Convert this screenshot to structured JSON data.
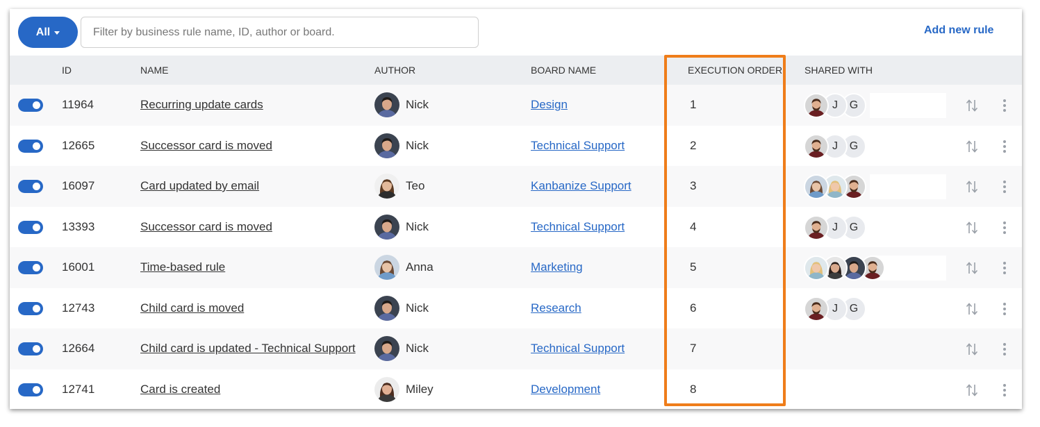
{
  "toolbar": {
    "filter_button": "All",
    "search_placeholder": "Filter by business rule name, ID, author or board.",
    "add_link": "Add new rule"
  },
  "columns": {
    "id": "ID",
    "name": "NAME",
    "author": "AUTHOR",
    "board": "BOARD NAME",
    "order": "EXECUTION ORDER",
    "shared": "SHARED WITH"
  },
  "colors": {
    "accent": "#2768c6",
    "highlight": "#ef7d1a",
    "header_bg": "#eceef1",
    "row_alt": "#f8f8f9"
  },
  "icons": {
    "filter": "chevron-down-icon",
    "row_sort": "sort-arrows-icon",
    "row_menu": "more-vertical-icon",
    "toggle": "toggle-switch-icon"
  },
  "rules": [
    {
      "enabled": true,
      "id": "11964",
      "name": "Recurring update cards",
      "author": "Nick",
      "author_avatar": "man-dark",
      "board": "Design",
      "order": "1",
      "shared": [
        {
          "type": "avatar",
          "kind": "man-beard"
        },
        {
          "type": "letter",
          "text": "J"
        },
        {
          "type": "letter",
          "text": "G"
        }
      ]
    },
    {
      "enabled": true,
      "id": "12665",
      "name": "Successor card is moved",
      "author": "Nick",
      "author_avatar": "man-dark",
      "board": "Technical Support",
      "order": "2",
      "shared": [
        {
          "type": "avatar",
          "kind": "man-beard"
        },
        {
          "type": "letter",
          "text": "J"
        },
        {
          "type": "letter",
          "text": "G"
        }
      ]
    },
    {
      "enabled": true,
      "id": "16097",
      "name": "Card updated by email",
      "author": "Teo",
      "author_avatar": "woman-long",
      "board": "Kanbanize Support",
      "order": "3",
      "shared": [
        {
          "type": "avatar",
          "kind": "woman-blue"
        },
        {
          "type": "avatar",
          "kind": "woman-blonde"
        },
        {
          "type": "avatar",
          "kind": "man-beard"
        }
      ]
    },
    {
      "enabled": true,
      "id": "13393",
      "name": "Successor card is moved",
      "author": "Nick",
      "author_avatar": "man-dark",
      "board": "Technical Support",
      "order": "4",
      "shared": [
        {
          "type": "avatar",
          "kind": "man-beard"
        },
        {
          "type": "letter",
          "text": "J"
        },
        {
          "type": "letter",
          "text": "G"
        }
      ]
    },
    {
      "enabled": true,
      "id": "16001",
      "name": "Time-based rule",
      "author": "Anna",
      "author_avatar": "woman-blue",
      "board": "Marketing",
      "order": "5",
      "shared": [
        {
          "type": "avatar",
          "kind": "woman-blonde"
        },
        {
          "type": "avatar",
          "kind": "woman-dark"
        },
        {
          "type": "avatar",
          "kind": "man-dark"
        },
        {
          "type": "avatar",
          "kind": "man-beard"
        }
      ]
    },
    {
      "enabled": true,
      "id": "12743",
      "name": "Child card is moved",
      "author": "Nick",
      "author_avatar": "man-dark",
      "board": "Research",
      "order": "6",
      "shared": [
        {
          "type": "avatar",
          "kind": "man-beard"
        },
        {
          "type": "letter",
          "text": "J"
        },
        {
          "type": "letter",
          "text": "G"
        }
      ]
    },
    {
      "enabled": true,
      "id": "12664",
      "name": "Child card is updated - Technical Support",
      "author": "Nick",
      "author_avatar": "man-dark",
      "board": "Technical Support",
      "order": "7",
      "shared": []
    },
    {
      "enabled": true,
      "id": "12741",
      "name": "Card is created",
      "author": "Miley",
      "author_avatar": "woman-curly",
      "board": "Development",
      "order": "8",
      "shared": []
    }
  ]
}
